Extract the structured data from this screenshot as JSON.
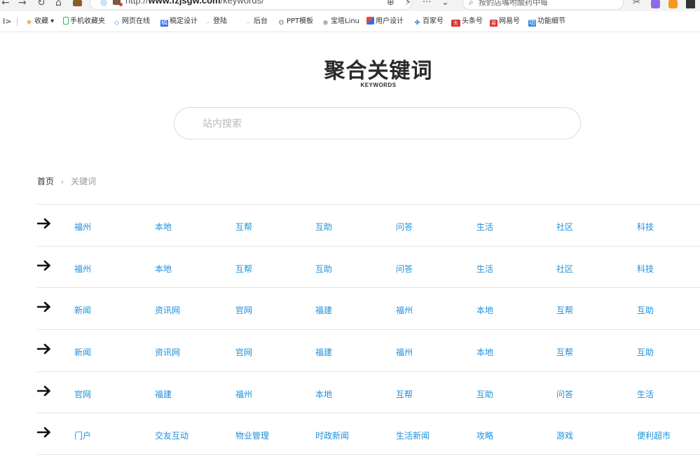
{
  "browser": {
    "url_prefix": "http://",
    "url_host": "www.fzjsgw.com",
    "url_path": "/keywords/",
    "search_placeholder": "按釣店嘴咐酸药中每",
    "icons": {
      "back": "back-arrow-icon",
      "forward": "forward-arrow-icon",
      "reload": "reload-icon",
      "home": "home-icon"
    },
    "bookmarks": [
      {
        "label": "收藏",
        "icon": "star-icon",
        "color": "#f5a623"
      },
      {
        "label": "手机收藏夹",
        "icon": "phone-icon",
        "color": "#2fb35e"
      },
      {
        "label": "网页在线",
        "icon": "code-icon",
        "color": "#3a8ee6"
      },
      {
        "label": "稿定设计",
        "icon": "gaoding-icon",
        "color": "#2b6ef5"
      },
      {
        "label": "登陆",
        "icon": "bird-icon",
        "color": "#f0a020"
      },
      {
        "label": "后台",
        "icon": "bird-icon",
        "color": "#f0a020"
      },
      {
        "label": "PPT模板",
        "icon": "owl-icon",
        "color": "#555555"
      },
      {
        "label": "宝塔Linu",
        "icon": "globe-icon",
        "color": "#666666"
      },
      {
        "label": "用户设计",
        "icon": "design-icon",
        "color": "#e84a2e"
      },
      {
        "label": "百家号",
        "icon": "paw-icon",
        "color": "#2f6fe0"
      },
      {
        "label": "头条号",
        "icon": "toutiao-icon",
        "color": "#e0332e"
      },
      {
        "label": "网易号",
        "icon": "netease-icon",
        "color": "#e0332e"
      },
      {
        "label": "功能细节",
        "icon": "feature-icon",
        "color": "#3a8ee6"
      }
    ]
  },
  "logo": {
    "title": "聚合关键词",
    "subtitle": "KEYWORDS"
  },
  "site_search": {
    "placeholder": "站内搜索"
  },
  "breadcrumb": {
    "home": "首页",
    "separator": "›",
    "current": "关键词"
  },
  "keyword_rows": [
    [
      "福州",
      "本地",
      "互帮",
      "互助",
      "问答",
      "生活",
      "社区",
      "科技"
    ],
    [
      "福州",
      "本地",
      "互帮",
      "互助",
      "问答",
      "生活",
      "社区",
      "科技"
    ],
    [
      "新闻",
      "资讯网",
      "官网",
      "福建",
      "福州",
      "本地",
      "互帮",
      "互助"
    ],
    [
      "新闻",
      "资讯网",
      "官网",
      "福建",
      "福州",
      "本地",
      "互帮",
      "互助"
    ],
    [
      "官网",
      "福建",
      "福州",
      "本地",
      "互帮",
      "互助",
      "问答",
      "生活"
    ],
    [
      "门户",
      "交友互动",
      "物业管理",
      "时政新闻",
      "生活新闻",
      "攻略",
      "游戏",
      "便利超市"
    ]
  ],
  "colors": {
    "link": "#1e90d9",
    "divider": "#e4e4e4"
  }
}
